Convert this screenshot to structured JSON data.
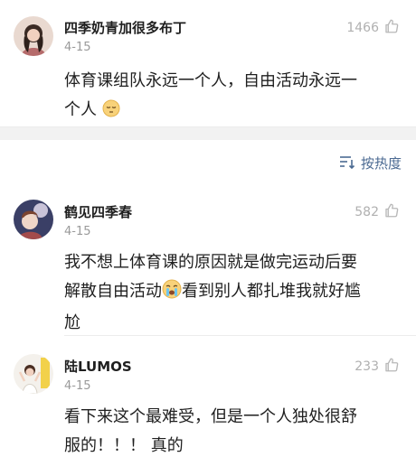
{
  "comments": [
    {
      "username": "四季奶青加很多布丁",
      "date": "4-15",
      "likes": "1466",
      "text_line1": "体育课组队永远一个人，自由活动永远一",
      "text_line2": "个人",
      "emoji": "sleepy-face"
    },
    {
      "username": "鹤见四季春",
      "date": "4-15",
      "likes": "582",
      "text_line1": "我不想上体育课的原因就是做完运动后要",
      "text_line2a": "解散自由活动",
      "emoji": "crying-face",
      "text_line2b": "看到别人都扎堆我就好尴",
      "text_line3": "尬"
    },
    {
      "username": "陆LUMOS",
      "date": "4-15",
      "likes": "233",
      "text_line1": "看下来这个最难受，但是一个人独处很舒",
      "text_line2": "服的！！！ 真的"
    }
  ],
  "sort": {
    "label": "按热度",
    "icon": "sort-icon"
  },
  "colors": {
    "link": "#4b6a92",
    "muted": "#9a9a9a",
    "band": "#f2f2f2"
  }
}
